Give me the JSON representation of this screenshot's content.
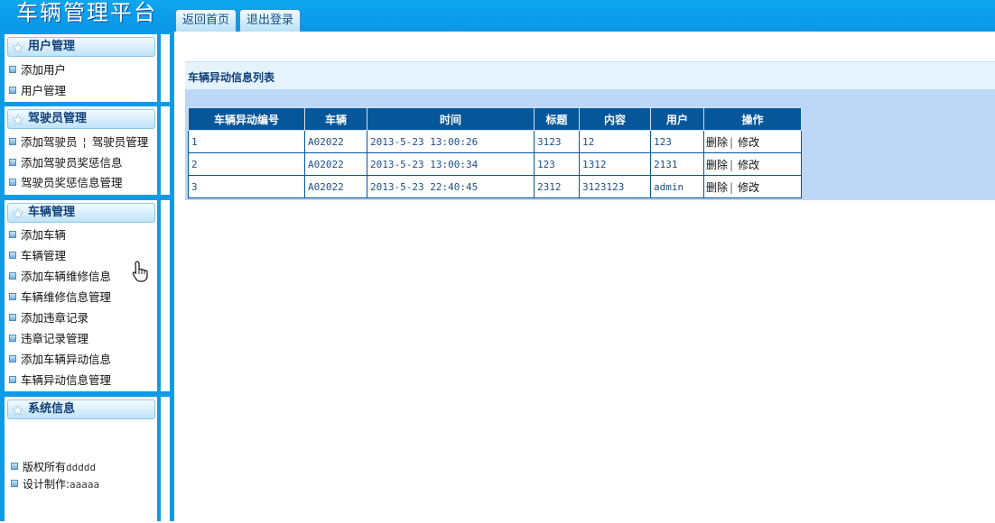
{
  "header": {
    "title": "车辆管理平台",
    "tabs": [
      {
        "label": "返回首页"
      },
      {
        "label": "退出登录"
      }
    ]
  },
  "sidebar": {
    "user_panel": {
      "title": "用户管理",
      "items": [
        "添加用户",
        "用户管理"
      ]
    },
    "driver_panel": {
      "title": "驾驶员管理",
      "items": [
        "添加驾驶员",
        "驾驶员管理",
        "添加驾驶员奖惩信息",
        "驾驶员奖惩信息管理"
      ],
      "separator": "¦"
    },
    "vehicle_panel": {
      "title": "车辆管理",
      "items": [
        "添加车辆",
        "车辆管理",
        "添加车辆维修信息",
        "车辆维修信息管理",
        "添加违章记录",
        "违章记录管理",
        "添加车辆异动信息",
        "车辆异动信息管理"
      ]
    },
    "system_panel": {
      "title": "系统信息",
      "copyright_label": "版权所有",
      "copyright_value": "ddddd",
      "design_label": "设计制作:",
      "design_value": "aaaaa"
    }
  },
  "main": {
    "list_title": "车辆异动信息列表",
    "columns": [
      "车辆异动编号",
      "车辆",
      "时间",
      "标题",
      "内容",
      "用户",
      "操作"
    ],
    "rows": [
      {
        "id": "1",
        "vehicle": "A02022",
        "time": "2013-5-23 13:00:26",
        "title": "3123",
        "content": "12",
        "user": "123"
      },
      {
        "id": "2",
        "vehicle": "A02022",
        "time": "2013-5-23 13:00:34",
        "title": "123",
        "content": "1312",
        "user": "2131"
      },
      {
        "id": "3",
        "vehicle": "A02022",
        "time": "2013-5-23 22:40:45",
        "title": "2312",
        "content": "3123123",
        "user": "admin"
      }
    ],
    "actions": {
      "delete": "删除",
      "edit": "修改",
      "separator": "|"
    }
  },
  "icons": {
    "panel_title": "star-icon",
    "nav_bullet": "square-bullet-icon",
    "pointer": "hand-cursor-icon"
  },
  "colors": {
    "header": "#0ea6ef",
    "sidebar": "#0d9be8",
    "table_header": "#06569a",
    "list_panel": "#bdd7f7"
  }
}
